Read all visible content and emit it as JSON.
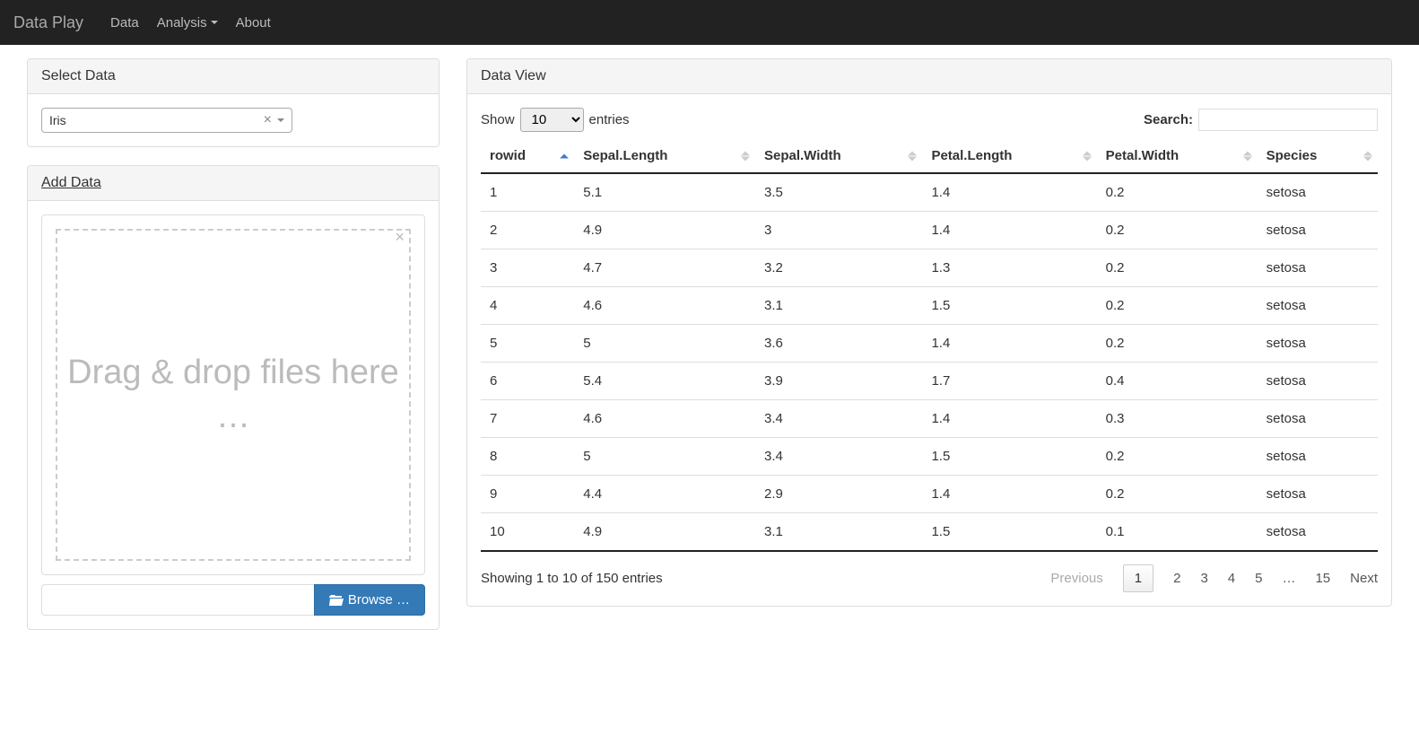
{
  "navbar": {
    "brand": "Data Play",
    "items": [
      {
        "label": "Data"
      },
      {
        "label": "Analysis",
        "dropdown": true
      },
      {
        "label": "About"
      }
    ]
  },
  "sidebar": {
    "select_panel_title": "Select Data",
    "selected_dataset": "Iris",
    "add_panel_title": "Add Data",
    "dropzone_text": "Drag & drop files here …",
    "browse_label": "Browse …",
    "browse_value": ""
  },
  "dataview": {
    "panel_title": "Data View",
    "show_label_pre": "Show",
    "show_label_post": "entries",
    "page_length": "10",
    "search_label": "Search:",
    "search_value": "",
    "columns": [
      "rowid",
      "Sepal.Length",
      "Sepal.Width",
      "Petal.Length",
      "Petal.Width",
      "Species"
    ],
    "sort_column": "rowid",
    "sort_dir": "asc",
    "rows": [
      [
        "1",
        "5.1",
        "3.5",
        "1.4",
        "0.2",
        "setosa"
      ],
      [
        "2",
        "4.9",
        "3",
        "1.4",
        "0.2",
        "setosa"
      ],
      [
        "3",
        "4.7",
        "3.2",
        "1.3",
        "0.2",
        "setosa"
      ],
      [
        "4",
        "4.6",
        "3.1",
        "1.5",
        "0.2",
        "setosa"
      ],
      [
        "5",
        "5",
        "3.6",
        "1.4",
        "0.2",
        "setosa"
      ],
      [
        "6",
        "5.4",
        "3.9",
        "1.7",
        "0.4",
        "setosa"
      ],
      [
        "7",
        "4.6",
        "3.4",
        "1.4",
        "0.3",
        "setosa"
      ],
      [
        "8",
        "5",
        "3.4",
        "1.5",
        "0.2",
        "setosa"
      ],
      [
        "9",
        "4.4",
        "2.9",
        "1.4",
        "0.2",
        "setosa"
      ],
      [
        "10",
        "4.9",
        "3.1",
        "1.5",
        "0.1",
        "setosa"
      ]
    ],
    "info_text": "Showing 1 to 10 of 150 entries",
    "paginator": {
      "prev": "Previous",
      "next": "Next",
      "pages": [
        "1",
        "2",
        "3",
        "4",
        "5",
        "…",
        "15"
      ],
      "current": "1"
    }
  }
}
